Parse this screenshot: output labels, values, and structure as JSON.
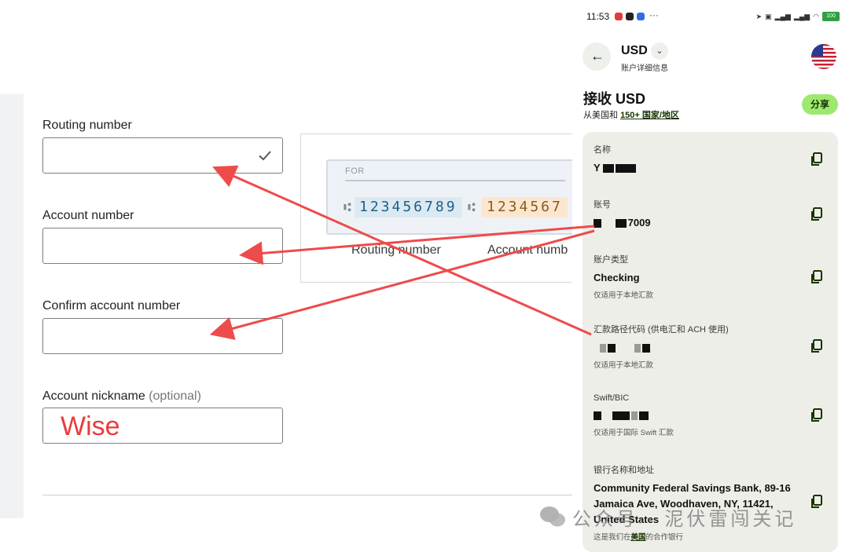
{
  "form": {
    "routing": {
      "label": "Routing number",
      "value": ""
    },
    "account": {
      "label": "Account number",
      "value": ""
    },
    "confirm": {
      "label": "Confirm account number",
      "value": ""
    },
    "nickname": {
      "label": "Account nickname",
      "optional": "(optional)",
      "value": "Wise",
      "value_color": "#ec3a3a"
    }
  },
  "check_illustration": {
    "for_label": "FOR",
    "routing_digits": "123456789",
    "account_digits": "1234567",
    "routing_caption": "Routing number",
    "account_caption": "Account numb"
  },
  "phone": {
    "status": {
      "time": "11:53",
      "overflow": "···",
      "icons": [
        "send-icon",
        "vpn-icon",
        "signal-5g-icon",
        "signal-5g-icon",
        "wifi-icon",
        "battery-icon"
      ],
      "battery": "100"
    },
    "header": {
      "currency": "USD",
      "subtitle": "账户详细信息",
      "flag": "us-flag"
    },
    "receive": {
      "title": "接收 USD",
      "sub_prefix": "从美国和 ",
      "sub_link": "150+ 国家/地区",
      "share": "分享"
    },
    "details": {
      "name": {
        "label": "名称",
        "value_visible": "Y"
      },
      "account_no": {
        "label": "账号",
        "value_visible": "7009"
      },
      "account_type": {
        "label": "账户类型",
        "value": "Checking",
        "note": "仅适用于本地汇款"
      },
      "routing": {
        "label": "汇款路径代码 (供电汇和 ACH 使用)",
        "note": "仅适用于本地汇款"
      },
      "swift": {
        "label": "Swift/BIC",
        "note": "仅适用于国际 Swift 汇款"
      },
      "bank": {
        "label": "银行名称和地址",
        "value_line1": "Community Federal Savings Bank, 89-16",
        "value_line2": "Jamaica Ave, Woodhaven, NY, 11421,",
        "value_line3": "United States",
        "note_prefix": "这是我们在",
        "note_link": "美国",
        "note_suffix": "的合作银行"
      }
    }
  },
  "watermark": {
    "text": "公众号 · 泥伏雷闯关记"
  },
  "colors": {
    "arrow": "#ee4b4b",
    "wise_green": "#9fe870",
    "wise_dark": "#163300",
    "card_bg": "#edeee8"
  }
}
